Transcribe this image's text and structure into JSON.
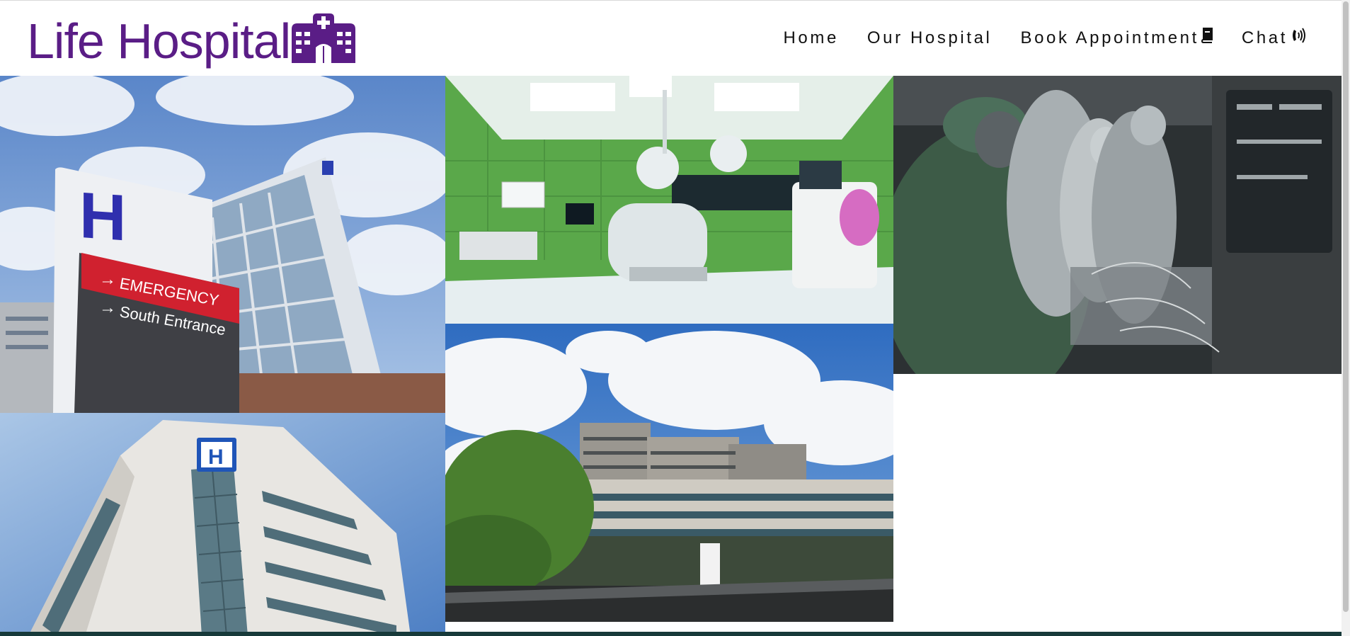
{
  "brand": {
    "name": "Life Hospital",
    "color": "#5a1d86"
  },
  "nav": {
    "items": [
      {
        "label": "Home",
        "icon": ""
      },
      {
        "label": "Our Hospital",
        "icon": ""
      },
      {
        "label": "Book Appointment",
        "icon": "book-icon"
      },
      {
        "label": "Chat",
        "icon": "phone-ringing-icon"
      }
    ]
  },
  "gallery": {
    "images": [
      {
        "subject": "hospital-exterior-emergency-sign"
      },
      {
        "subject": "operating-room"
      },
      {
        "subject": "surgeons-in-operation"
      },
      {
        "subject": "hospital-building-h-sign"
      },
      {
        "subject": "hospital-campus-under-sky"
      }
    ]
  }
}
